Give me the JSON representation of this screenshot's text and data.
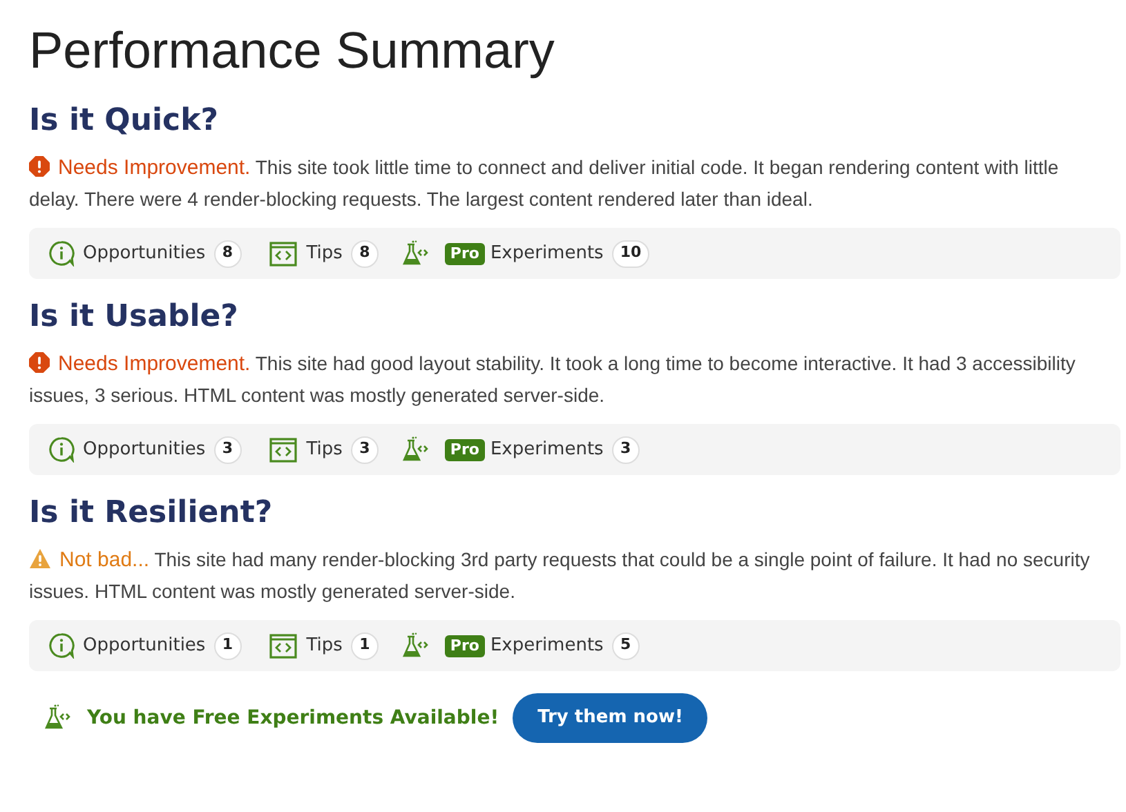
{
  "title": "Performance Summary",
  "sections": [
    {
      "heading": "Is it Quick?",
      "status": {
        "kind": "poor",
        "label": "Needs Improvement."
      },
      "text": "This site took little time to connect and deliver initial code. It began rendering content with little delay. There were 4 render-blocking requests. The largest content rendered later than ideal.",
      "opportunities": {
        "label": "Opportunities",
        "count": "8"
      },
      "tips": {
        "label": "Tips",
        "count": "8"
      },
      "experiments": {
        "badge": "Pro",
        "label": "Experiments",
        "count": "10"
      }
    },
    {
      "heading": "Is it Usable?",
      "status": {
        "kind": "poor",
        "label": "Needs Improvement."
      },
      "text": "This site had good layout stability. It took a long time to become interactive. It had 3 accessibility issues, 3 serious. HTML content was mostly generated server-side.",
      "opportunities": {
        "label": "Opportunities",
        "count": "3"
      },
      "tips": {
        "label": "Tips",
        "count": "3"
      },
      "experiments": {
        "badge": "Pro",
        "label": "Experiments",
        "count": "3"
      }
    },
    {
      "heading": "Is it Resilient?",
      "status": {
        "kind": "fair",
        "label": "Not bad..."
      },
      "text": "This site had many render-blocking 3rd party requests that could be a single point of failure. It had no security issues. HTML content was mostly generated server-side.",
      "opportunities": {
        "label": "Opportunities",
        "count": "1"
      },
      "tips": {
        "label": "Tips",
        "count": "1"
      },
      "experiments": {
        "badge": "Pro",
        "label": "Experiments",
        "count": "5"
      }
    }
  ],
  "promo": {
    "text": "You have Free Experiments Available!",
    "button": "Try them now!"
  }
}
